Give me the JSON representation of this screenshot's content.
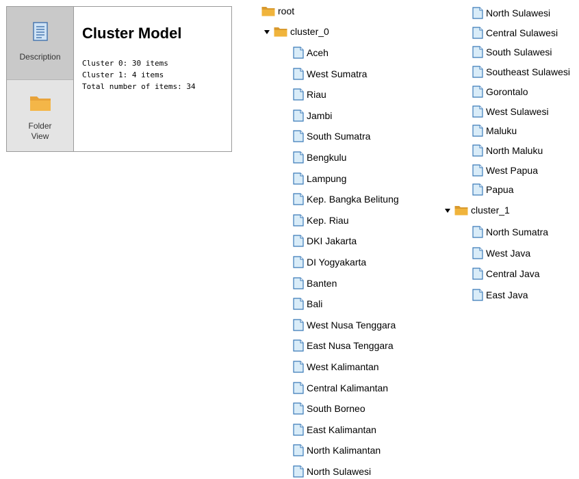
{
  "panel": {
    "tabs": {
      "description": {
        "label": "Description",
        "icon": "document-icon"
      },
      "folder_view": {
        "label": "Folder\nView",
        "icon": "folder-icon"
      }
    },
    "title": "Cluster Model",
    "lines": [
      "Cluster 0: 30 items",
      "Cluster 1: 4 items",
      "Total number of items: 34"
    ]
  },
  "tree": {
    "root_label": "root",
    "clusters": [
      {
        "label": "cluster_0",
        "items": [
          "Aceh",
          "West Sumatra",
          "Riau",
          "Jambi",
          "South Sumatra",
          "Bengkulu",
          "Lampung",
          "Kep. Bangka Belitung",
          "Kep. Riau",
          "DKI Jakarta",
          "DI Yogyakarta",
          "Banten",
          "Bali",
          "West Nusa Tenggara",
          "East Nusa Tenggara",
          "West Kalimantan",
          "Central Kalimantan",
          "South Borneo",
          "East Kalimantan",
          "North Kalimantan",
          "North Sulawesi",
          "North Sulawesi",
          "Central Sulawesi",
          "South Sulawesi",
          "Southeast Sulawesi",
          "Gorontalo",
          "West Sulawesi",
          "Maluku",
          "North Maluku",
          "West Papua",
          "Papua"
        ]
      },
      {
        "label": "cluster_1",
        "items": [
          "North Sumatra",
          "West Java",
          "Central Java",
          "East Java"
        ]
      }
    ]
  },
  "colors": {
    "folder": "#f0b43c",
    "doc_fill": "#d9ecf8",
    "doc_stroke": "#3a7ab8",
    "tab_active": "#c9c9c9"
  }
}
